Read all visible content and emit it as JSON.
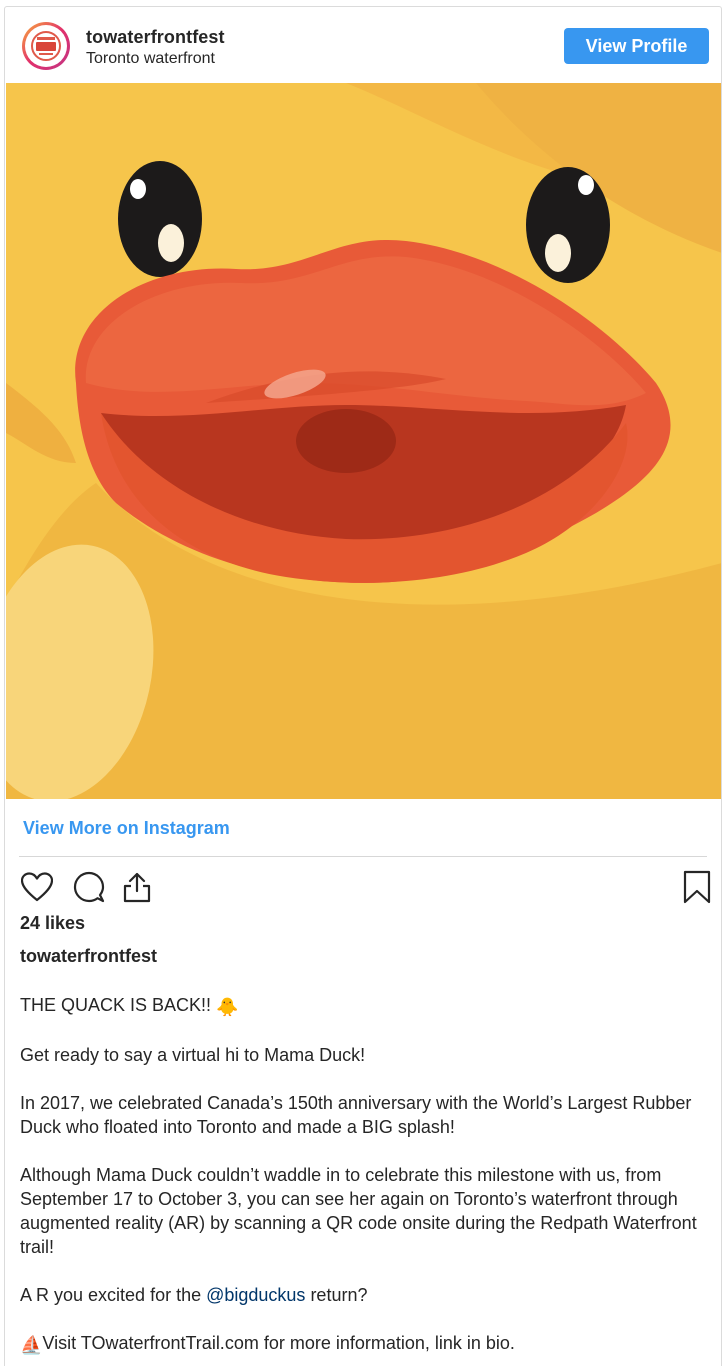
{
  "header": {
    "username": "towaterfrontfest",
    "location": "Toronto waterfront",
    "view_profile_label": "View Profile"
  },
  "post": {
    "image_description_icon": "rubber-duck-face-illustration",
    "view_more_label": "View More on Instagram",
    "likes_text": "24 likes",
    "caption_username": "towaterfrontfest",
    "caption": {
      "line1": "THE QUACK IS BACK!!",
      "line1_emoji": "🐥",
      "line2": "Get ready to say a virtual hi to Mama Duck!",
      "para3": "In 2017, we celebrated Canada’s 150th anniversary with the World’s Largest Rubber Duck who floated into Toronto and made a BIG splash!",
      "para4": "Although Mama Duck couldn’t waddle in to celebrate this milestone with us, from September 17 to October 3, you can see her again on Toronto’s waterfront through augmented reality (AR) by scanning a QR code onsite during the Redpath Waterfront trail!",
      "para5_prefix": "A R you excited for the ",
      "para5_mention": "@bigduckus",
      "para5_suffix": " return?",
      "para6_emoji": "⛵",
      "para6": "Visit TOwaterfrontTrail.com for more information, link in bio."
    }
  },
  "icons": {
    "like": "heart-icon",
    "comment": "comment-icon",
    "share": "share-icon",
    "save": "bookmark-icon"
  },
  "colors": {
    "accent": "#3897f0",
    "mention": "#003569",
    "duck_yellow": "#f5c44a",
    "beak_orange": "#e8603c"
  }
}
